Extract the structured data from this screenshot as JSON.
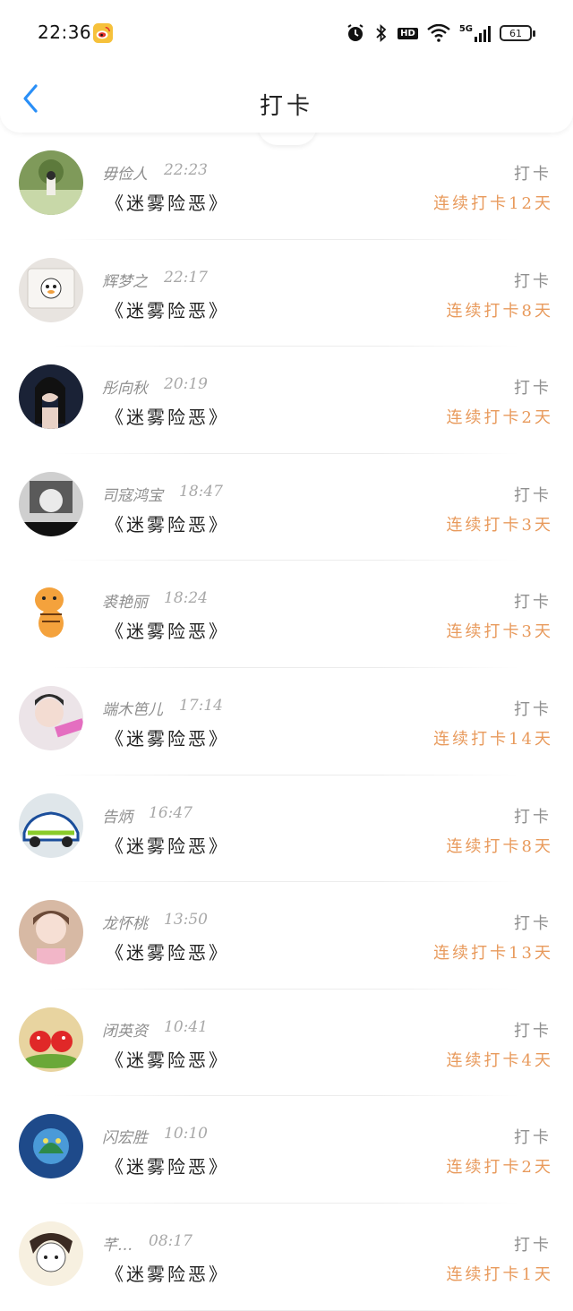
{
  "status_bar": {
    "time": "22:36",
    "battery": "61",
    "icons": [
      "weibo-icon",
      "alarm-icon",
      "bluetooth-icon",
      "hd-icon",
      "wifi-icon",
      "5g-signal-icon",
      "battery-icon"
    ],
    "hd_label": "HD",
    "network_label": "5G"
  },
  "nav": {
    "title": "打卡",
    "back_icon": "chevron-left-icon",
    "accent": "#2a8ff7"
  },
  "colors": {
    "streak": "#e89a5c",
    "muted": "#8f8f8f",
    "text": "#222222"
  },
  "checkins": [
    {
      "name": "毋俭人",
      "time": "22:23",
      "book": "《迷雾险恶》",
      "action": "打卡",
      "streak": "连续打卡12天"
    },
    {
      "name": "辉梦之",
      "time": "22:17",
      "book": "《迷雾险恶》",
      "action": "打卡",
      "streak": "连续打卡8天"
    },
    {
      "name": "彤向秋",
      "time": "20:19",
      "book": "《迷雾险恶》",
      "action": "打卡",
      "streak": "连续打卡2天"
    },
    {
      "name": "司寇鸿宝",
      "time": "18:47",
      "book": "《迷雾险恶》",
      "action": "打卡",
      "streak": "连续打卡3天"
    },
    {
      "name": "裘艳丽",
      "time": "18:24",
      "book": "《迷雾险恶》",
      "action": "打卡",
      "streak": "连续打卡3天"
    },
    {
      "name": "端木笆儿",
      "time": "17:14",
      "book": "《迷雾险恶》",
      "action": "打卡",
      "streak": "连续打卡14天"
    },
    {
      "name": "告炳",
      "time": "16:47",
      "book": "《迷雾险恶》",
      "action": "打卡",
      "streak": "连续打卡8天"
    },
    {
      "name": "龙怀桃",
      "time": "13:50",
      "book": "《迷雾险恶》",
      "action": "打卡",
      "streak": "连续打卡13天"
    },
    {
      "name": "闭英资",
      "time": "10:41",
      "book": "《迷雾险恶》",
      "action": "打卡",
      "streak": "连续打卡4天"
    },
    {
      "name": "闪宏胜",
      "time": "10:10",
      "book": "《迷雾险恶》",
      "action": "打卡",
      "streak": "连续打卡2天"
    },
    {
      "name": "芊…",
      "time": "08:17",
      "book": "《迷雾险恶》",
      "action": "打卡",
      "streak": "连续打卡1天"
    }
  ]
}
